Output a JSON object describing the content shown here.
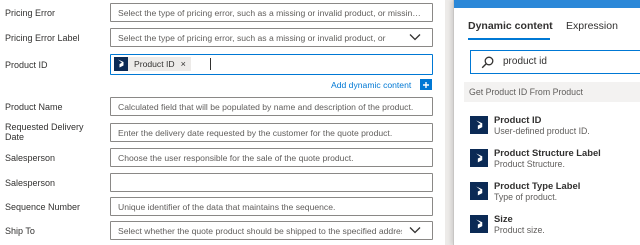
{
  "form": {
    "rows": [
      {
        "label": "Pricing Error",
        "placeholder": "Select the type of pricing error, such as a missing or invalid product, or missing quantity."
      },
      {
        "label": "Pricing Error Label",
        "placeholder": "Select the type of pricing error, such as a missing or invalid product, or"
      },
      {
        "label": "Product ID"
      },
      {
        "label": "Product Name",
        "placeholder": "Calculated field that will be populated by name and description of the product."
      },
      {
        "label": "Requested Delivery Date",
        "placeholder": "Enter the delivery date requested by the customer for the quote product."
      },
      {
        "label": "Salesperson",
        "placeholder": "Choose the user responsible for the sale of the quote product."
      },
      {
        "label": "Salesperson",
        "placeholder": ""
      },
      {
        "label": "Sequence Number",
        "placeholder": "Unique identifier of the data that maintains the sequence."
      },
      {
        "label": "Ship To",
        "placeholder": "Select whether the quote product should be shipped to the specified address or"
      }
    ],
    "product_id_token": "Product ID",
    "token_remove": "×",
    "add_dynamic_content": "Add dynamic content"
  },
  "panel": {
    "tabs": [
      {
        "label": "Dynamic content",
        "active": true
      },
      {
        "label": "Expression",
        "active": false
      }
    ],
    "search": {
      "value": "product id"
    },
    "group_label": "Get Product ID From Product",
    "items": [
      {
        "title": "Product ID",
        "desc": "User-defined product ID."
      },
      {
        "title": "Product Structure Label",
        "desc": "Product Structure."
      },
      {
        "title": "Product Type Label",
        "desc": "Type of product."
      },
      {
        "title": "Size",
        "desc": "Product size."
      }
    ]
  },
  "colors": {
    "accent": "#0078d4",
    "icon_bg": "#0b2a55",
    "panel_top": "#2b88d8"
  },
  "icons": {
    "dropdown": "chevron-down-icon",
    "token": "dynamics-logo-icon",
    "search": "search-icon",
    "add": "plus-icon"
  }
}
